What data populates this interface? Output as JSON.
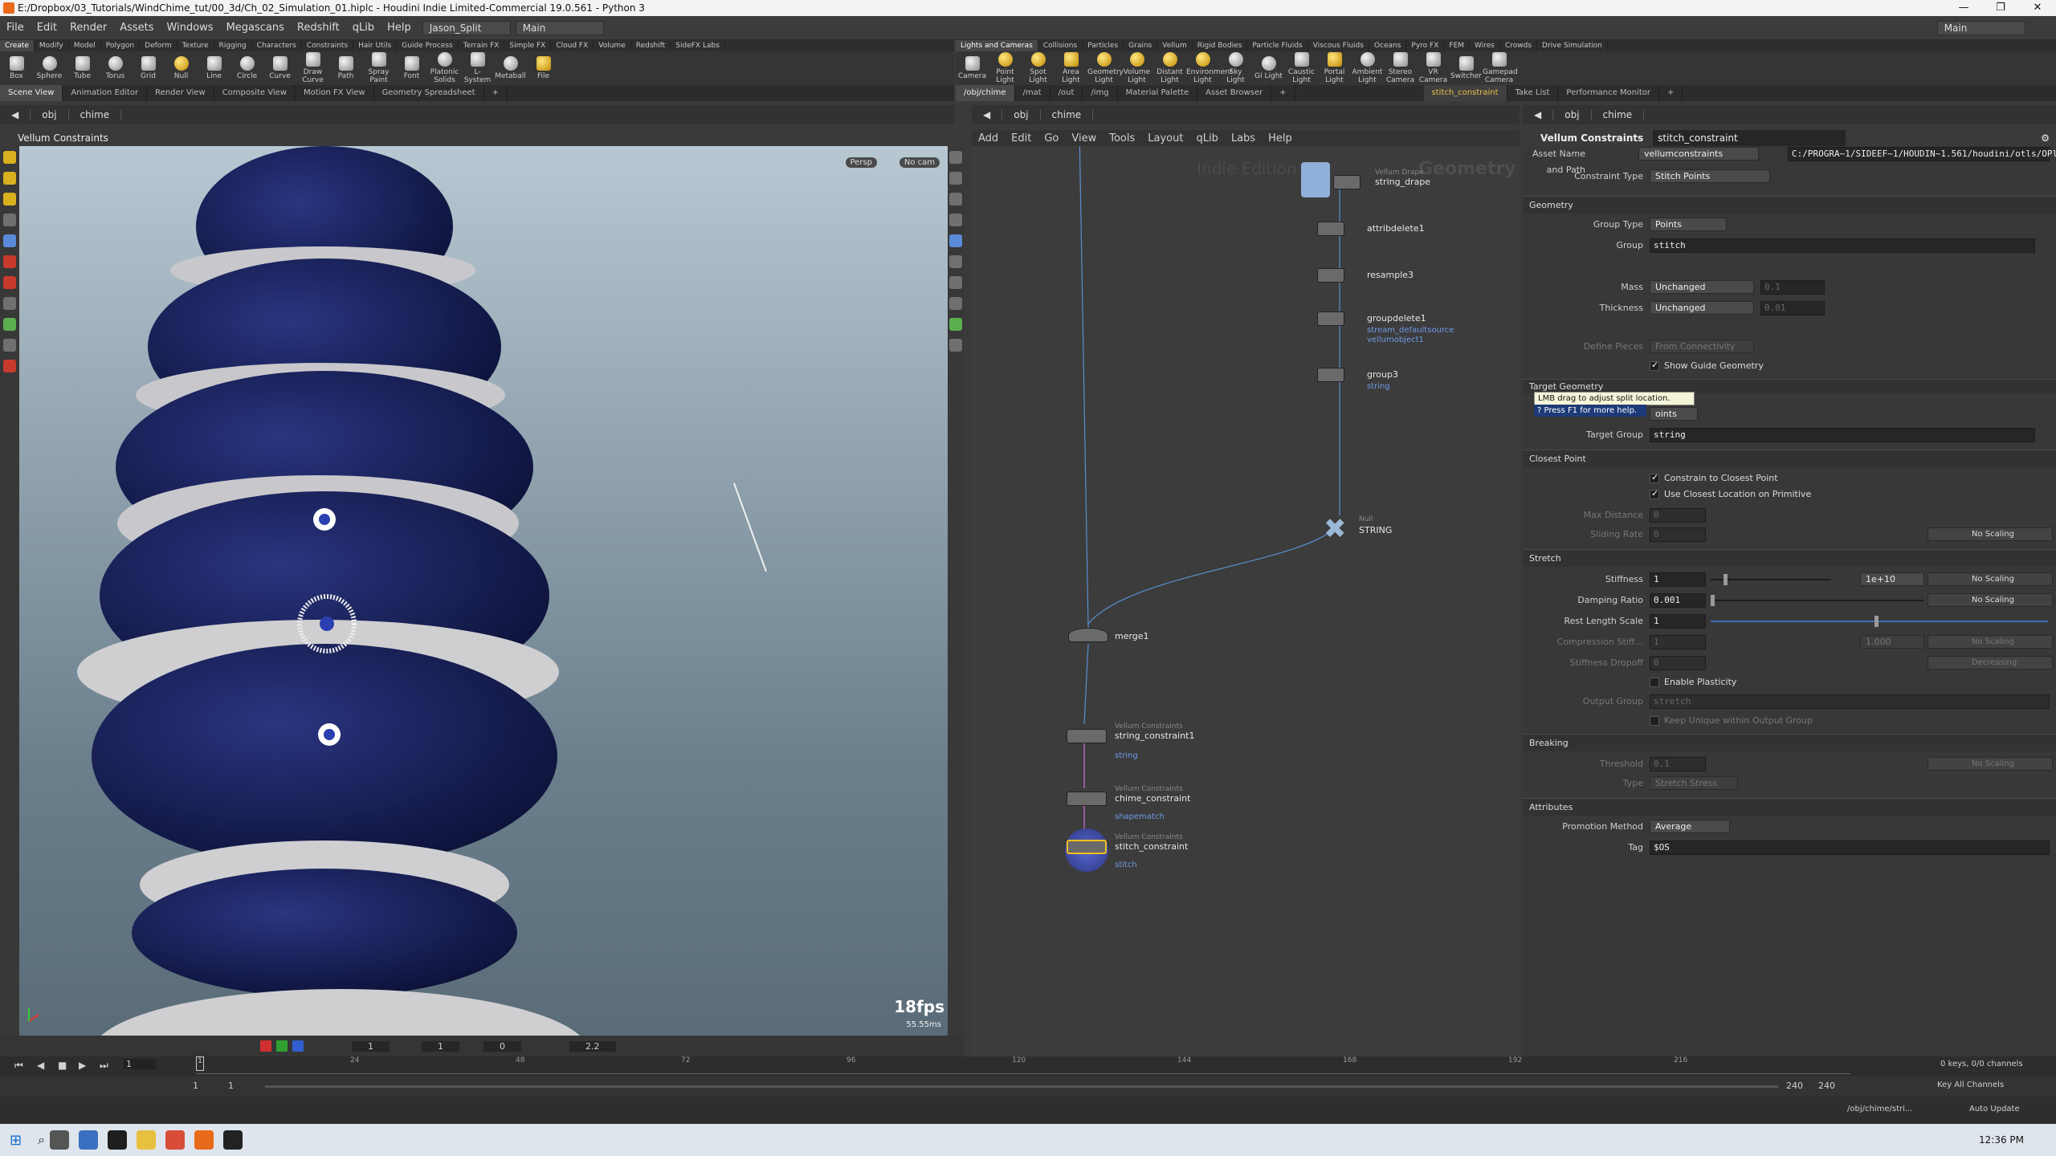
{
  "window": {
    "title": "E:/Dropbox/03_Tutorials/WindChime_tut/00_3d/Ch_02_Simulation_01.hiplc - Houdini Indie Limited-Commercial 19.0.561 - Python 3"
  },
  "menus": [
    "File",
    "Edit",
    "Render",
    "Assets",
    "Windows",
    "Megascans",
    "Redshift",
    "qLib",
    "Help"
  ],
  "desktop": "Jason_Split",
  "desktop2": "Main",
  "workspace": "Main",
  "shelf_tabs": [
    "Create",
    "Modify",
    "Model",
    "Polygon",
    "Deform",
    "Texture",
    "Rigging",
    "Characters",
    "Constraints",
    "Hair Utils",
    "Guide Process",
    "Terrain FX",
    "Simple FX",
    "Cloud FX",
    "Volume",
    "Redshift",
    "SideFX Labs"
  ],
  "shelf_tools": [
    "Box",
    "Sphere",
    "Tube",
    "Torus",
    "Grid",
    "Null",
    "Line",
    "Circle",
    "Curve",
    "Draw Curve",
    "Path",
    "Spray Paint",
    "Font",
    "Platonic Solids",
    "L-System",
    "Metaball",
    "File"
  ],
  "shelf2_tabs": [
    "Lights and Cameras",
    "Collisions",
    "Particles",
    "Grains",
    "Vellum",
    "Rigid Bodies",
    "Particle Fluids",
    "Viscous Fluids",
    "Oceans",
    "Pyro FX",
    "FEM",
    "Wires",
    "Crowds",
    "Drive Simulation"
  ],
  "shelf2_tools": [
    "Camera",
    "Point Light",
    "Spot Light",
    "Area Light",
    "Geometry Light",
    "Volume Light",
    "Distant Light",
    "Environment Light",
    "Sky Light",
    "GI Light",
    "Caustic Light",
    "Portal Light",
    "Ambient Light",
    "Stereo Camera",
    "VR Camera",
    "Switcher",
    "Gamepad Camera"
  ],
  "pane_tabs_left": [
    "Scene View",
    "Animation Editor",
    "Render View",
    "Composite View",
    "Motion FX View",
    "Geometry Spreadsheet"
  ],
  "pane_tabs_mid": [
    "/obj/chime",
    "/mat",
    "/out",
    "/img",
    "Material Palette",
    "Asset Browser"
  ],
  "pane_tabs_right": [
    "stitch_constraint",
    "Take List",
    "Performance Monitor"
  ],
  "path": {
    "root": "obj",
    "node": "chime"
  },
  "viewport": {
    "title": "Vellum Constraints",
    "persp": "Persp",
    "cam": "No cam",
    "fps": "18fps",
    "ms": "55.55ms"
  },
  "viewport_bar": {
    "v1": "1",
    "v2": "1",
    "v3": "0",
    "v4": "2.2"
  },
  "network": {
    "menu": [
      "Add",
      "Edit",
      "Go",
      "View",
      "Tools",
      "Layout",
      "qLib",
      "Labs",
      "Help"
    ],
    "watermark1": "Indie Edition",
    "watermark2": "Geometry",
    "nodes": [
      {
        "type": "Vellum Drape",
        "name": "string_drape",
        "sub": ""
      },
      {
        "type": "",
        "name": "attribdelete1",
        "sub": ""
      },
      {
        "type": "",
        "name": "resample3",
        "sub": ""
      },
      {
        "type": "",
        "name": "groupdelete1",
        "sub": "stream_defaultsource",
        "sub2": "vellumobject1"
      },
      {
        "type": "",
        "name": "group3",
        "sub": "string"
      },
      {
        "type": "Null",
        "name": "STRING",
        "sub": ""
      },
      {
        "type": "",
        "name": "merge1",
        "sub": ""
      },
      {
        "type": "Vellum Constraints",
        "name": "string_constraint1",
        "sub": "string"
      },
      {
        "type": "Vellum Constraints",
        "name": "chime_constraint",
        "sub": "shapematch"
      },
      {
        "type": "Vellum Constraints",
        "name": "stitch_constraint",
        "sub": "stitch"
      }
    ]
  },
  "params": {
    "header": "Vellum Constraints",
    "node": "stitch_constraint",
    "asset_label": "Asset Name and Path",
    "asset_name": "vellumconstraints",
    "asset_path": "C:/PROGRA~1/SIDEEF~1/HOUDIN~1.561/houdini/otls/OPli...",
    "ctype_label": "Constraint Type",
    "ctype": "Stitch Points",
    "geometry": "Geometry",
    "group_type_label": "Group Type",
    "group_type": "Points",
    "group_label": "Group",
    "group": "stitch",
    "mass_label": "Mass",
    "mass": "Unchanged",
    "mass_v": "0.1",
    "thick_label": "Thickness",
    "thick": "Unchanged",
    "thick_v": "0.01",
    "define_label": "Define Pieces",
    "define": "From Connectivity",
    "show_guide": "Show Guide Geometry",
    "target": "Target Geometry",
    "tooltip1": "LMB drag to adjust split location.",
    "tooltip2": "Press F1 for more help.",
    "target_type": "oints",
    "tgroup_label": "Target Group",
    "tgroup": "string",
    "closest": "Closest Point",
    "c1": "Constrain to Closest Point",
    "c2": "Use Closest Location on Primitive",
    "maxd_label": "Max Distance",
    "maxd": "0",
    "slide_label": "Sliding Rate",
    "slide": "0",
    "noscale": "No Scaling",
    "stretch": "Stretch",
    "stiff_label": "Stiffness",
    "stiff": "1",
    "stiff_mult": "1e+10",
    "damp_label": "Damping Ratio",
    "damp": "0.001",
    "rest_label": "Rest Length Scale",
    "rest": "1",
    "comp_label": "Compression Stiff...",
    "comp": "1",
    "comp_mult": "1.000",
    "drop_label": "Stiffness Dropoff",
    "drop": "0",
    "decreasing": "Decreasing",
    "plastic": "Enable Plasticity",
    "outg_label": "Output Group",
    "outg": "stretch",
    "keep": "Keep Unique within Output Group",
    "breaking": "Breaking",
    "thr_label": "Threshold",
    "thr": "0.1",
    "type_label": "Type",
    "type": "Stretch Stress",
    "attrs": "Attributes",
    "promo_label": "Promotion Method",
    "promo": "Average",
    "tag_label": "Tag",
    "tag": "$OS"
  },
  "timeline": {
    "ticks": [
      "24",
      "48",
      "72",
      "96",
      "120",
      "144",
      "168",
      "192",
      "216"
    ],
    "frame": "1",
    "start": "1",
    "start2": "1",
    "end": "240",
    "end2": "240",
    "keys": "0 keys, 0/0 channels",
    "keyall": "Key All Channels",
    "path": "/obj/chime/stri...",
    "auto": "Auto Update"
  },
  "clock": "12:36 PM"
}
